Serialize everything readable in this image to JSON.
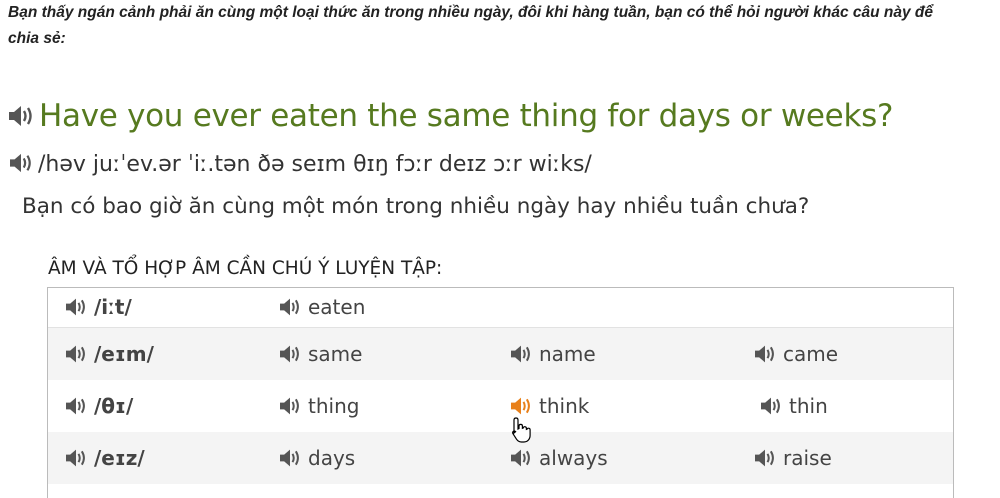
{
  "intro": "Bạn thấy ngán cảnh phải ăn cùng một loại thức ăn trong nhiều ngày, đôi khi hàng tuần, bạn có thể hỏi người khác câu này để chia sẻ:",
  "headline": "Have you ever eaten the same thing for days or weeks?",
  "ipa": "/həv juːˈev.ər ˈiː.tən ðə seɪm θɪŋ fɔːr deɪz ɔːr wiːks/",
  "translation": "Bạn có bao giờ ăn cùng một món trong nhiều ngày hay nhiều tuần chưa?",
  "section_title": "ÂM VÀ TỔ HỢP ÂM CẦN CHÚ Ý LUYỆN TẬP:",
  "colors": {
    "headline": "#567a1f",
    "speaker": "#555555",
    "speaker_active": "#e8801a"
  },
  "rows": [
    {
      "sound": "/iːt/",
      "words": [
        "eaten"
      ]
    },
    {
      "sound": "/eɪm/",
      "words": [
        "same",
        "name",
        "came"
      ]
    },
    {
      "sound": "/θɪ/",
      "words": [
        "thing",
        "think",
        "thin"
      ]
    },
    {
      "sound": "/eɪz/",
      "words": [
        "days",
        "always",
        "raise"
      ]
    }
  ]
}
